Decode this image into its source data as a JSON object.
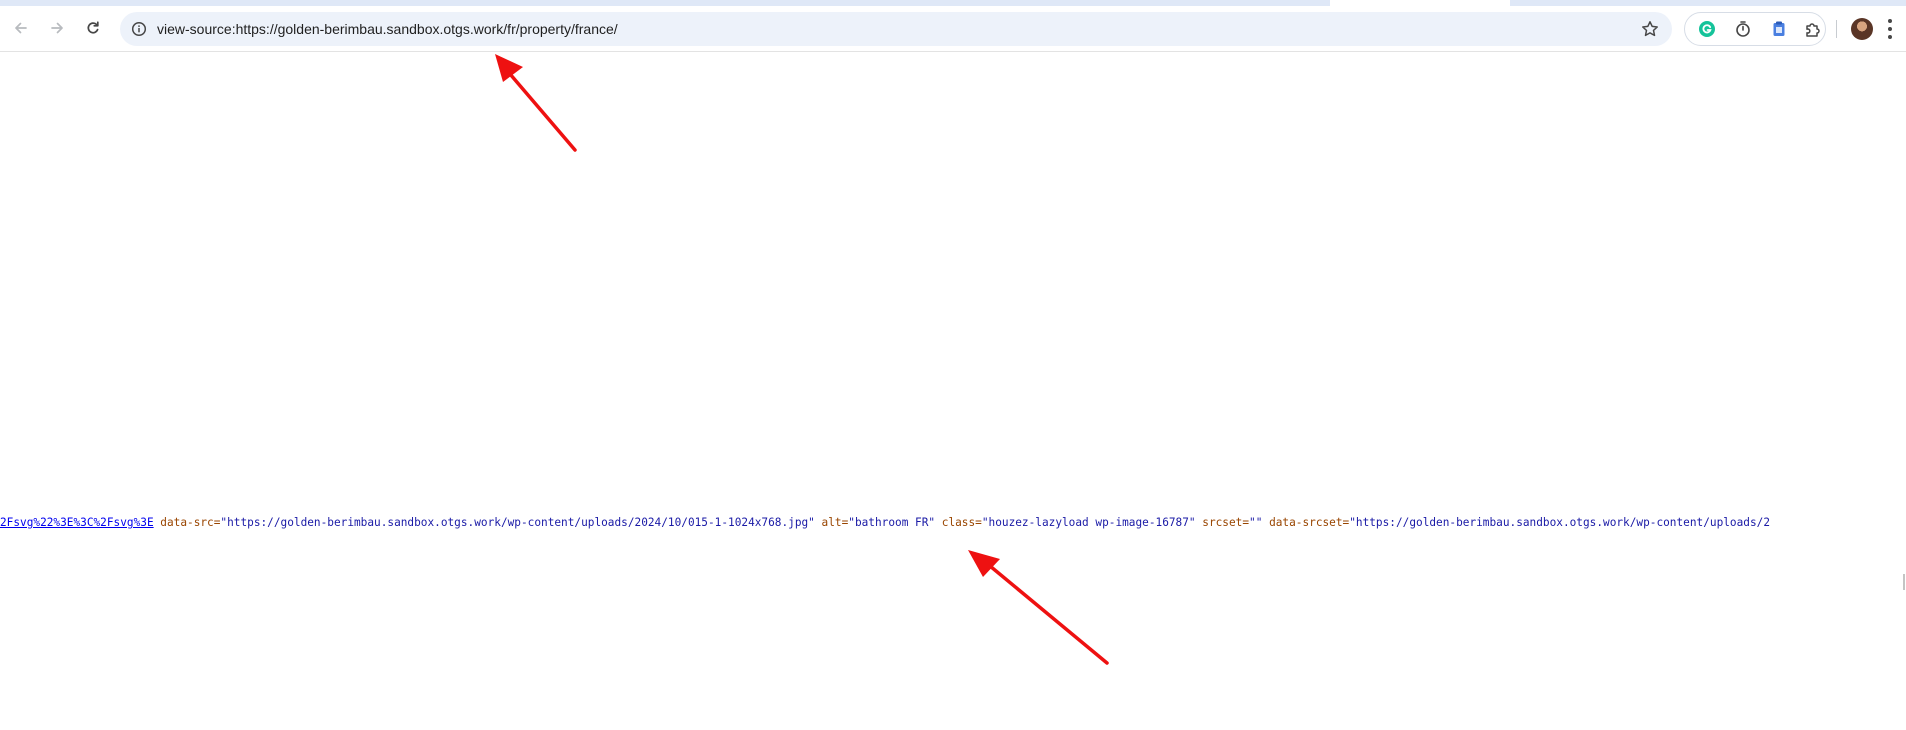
{
  "browser": {
    "nav": {
      "back_icon": "arrow-left-icon",
      "forward_icon": "arrow-right-icon",
      "reload_icon": "reload-icon"
    },
    "address_bar": {
      "url": "view-source:https://golden-berimbau.sandbox.otgs.work/fr/property/france/",
      "site_info_icon": "info-circle-icon",
      "bookmark_icon": "star-icon"
    },
    "extensions": [
      "grammarly-icon",
      "timer-icon",
      "clipboard-icon",
      "puzzle-icon"
    ],
    "profile_icon": "avatar",
    "menu_icon": "kebab-menu-icon"
  },
  "source_line": {
    "link_text": "2Fsvg%22%3E%3C%2Fsvg%3E",
    "tokens": [
      {
        "type": "attr",
        "text": " data-src="
      },
      {
        "type": "val",
        "text": "\"https://golden-berimbau.sandbox.otgs.work/wp-content/uploads/2024/10/015-1-1024x768.jpg\""
      },
      {
        "type": "attr",
        "text": " alt="
      },
      {
        "type": "val",
        "text": "\"bathroom FR\""
      },
      {
        "type": "attr",
        "text": " class="
      },
      {
        "type": "val",
        "text": "\"houzez-lazyload wp-image-16787\""
      },
      {
        "type": "attr",
        "text": " srcset="
      },
      {
        "type": "val",
        "text": "\"\""
      },
      {
        "type": "attr",
        "text": " data-srcset="
      },
      {
        "type": "val",
        "text": "\"https://golden-berimbau.sandbox.otgs.work/wp-content/uploads/2"
      }
    ]
  },
  "colors": {
    "attr": "#994500",
    "value": "#1a1aa6",
    "link": "#0000ee",
    "annotation_arrow": "#ee1111"
  }
}
